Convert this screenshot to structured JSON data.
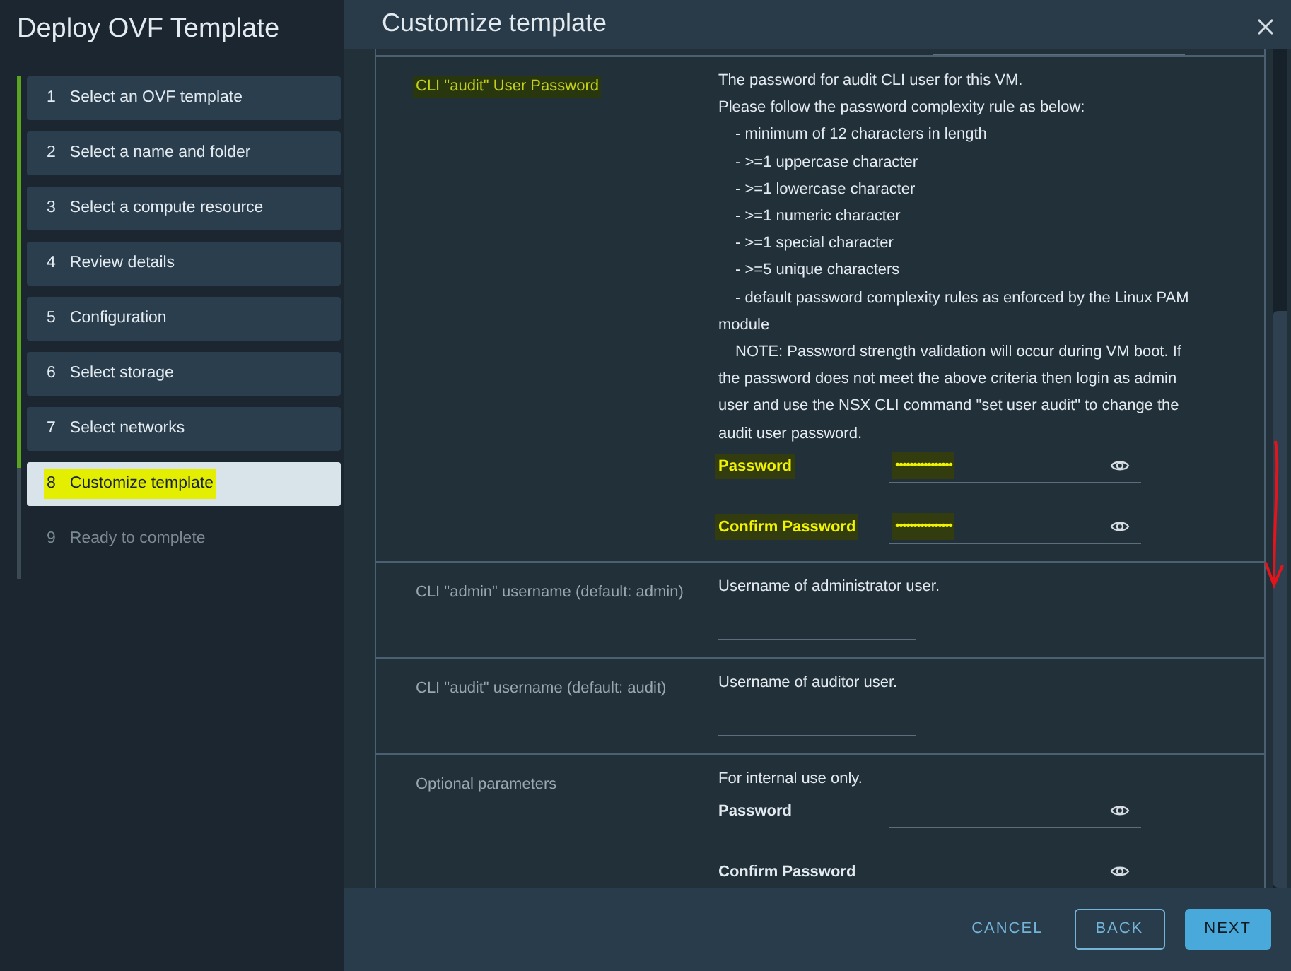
{
  "wizard": {
    "title": "Deploy OVF Template",
    "steps": [
      {
        "number": "1",
        "label": "Select an OVF template",
        "completed": true,
        "selected": false,
        "highlighted": false
      },
      {
        "number": "2",
        "label": "Select a name and folder",
        "completed": true,
        "selected": false,
        "highlighted": false
      },
      {
        "number": "3",
        "label": "Select a compute resource",
        "completed": true,
        "selected": false,
        "highlighted": false
      },
      {
        "number": "4",
        "label": "Review details",
        "completed": true,
        "selected": false,
        "highlighted": false
      },
      {
        "number": "5",
        "label": "Configuration",
        "completed": true,
        "selected": false,
        "highlighted": false
      },
      {
        "number": "6",
        "label": "Select storage",
        "completed": true,
        "selected": false,
        "highlighted": false
      },
      {
        "number": "7",
        "label": "Select networks",
        "completed": true,
        "selected": false,
        "highlighted": false
      },
      {
        "number": "8",
        "label": "Customize template",
        "completed": false,
        "selected": true,
        "highlighted": true
      },
      {
        "number": "9",
        "label": "Ready to complete",
        "completed": false,
        "selected": false,
        "highlighted": false
      }
    ]
  },
  "page": {
    "title": "Customize template"
  },
  "properties": [
    {
      "label": "CLI \"audit\" User Password",
      "highlighted": true,
      "description": [
        {
          "kind": "line",
          "text": "The password for audit CLI user for this VM."
        },
        {
          "kind": "line",
          "text": "Please follow the password complexity rule as below:"
        },
        {
          "kind": "rule",
          "text": "- minimum of 12 characters in length"
        },
        {
          "kind": "rule",
          "text": "- >=1 uppercase character"
        },
        {
          "kind": "rule",
          "text": "- >=1 lowercase character"
        },
        {
          "kind": "rule",
          "text": "- >=1 numeric character"
        },
        {
          "kind": "rule",
          "text": "- >=1 special character"
        },
        {
          "kind": "rule",
          "text": "- >=5 unique characters"
        },
        {
          "kind": "rule_wrap",
          "text": "- default password complexity rules as enforced by the Linux PAM module"
        },
        {
          "kind": "note",
          "text": "NOTE: Password strength validation will occur during VM boot.  If the password does not meet the above criteria then login as admin user and use the NSX CLI command \"set user audit\" to change the audit user password."
        }
      ],
      "fields": [
        {
          "kind": "password",
          "label": "Password",
          "value": "••••••••••••••••",
          "highlighted": true
        },
        {
          "kind": "password",
          "label": "Confirm Password",
          "value": "••••••••••••••••",
          "highlighted": true
        }
      ]
    },
    {
      "label": "CLI \"admin\" username (default: admin)",
      "highlighted": false,
      "description": [
        {
          "kind": "line",
          "text": "Username of administrator user."
        }
      ],
      "fields": [
        {
          "kind": "text"
        }
      ]
    },
    {
      "label": "CLI \"audit\" username (default: audit)",
      "highlighted": false,
      "description": [
        {
          "kind": "line",
          "text": "Username of auditor user."
        }
      ],
      "fields": [
        {
          "kind": "text"
        }
      ]
    },
    {
      "label": "Optional parameters",
      "highlighted": false,
      "description": [
        {
          "kind": "line",
          "text": "For internal use only."
        }
      ],
      "fields": [
        {
          "kind": "password",
          "label": "Password",
          "highlighted": false
        },
        {
          "kind": "password",
          "label": "Confirm Password",
          "highlighted": false
        }
      ]
    }
  ],
  "buttons": [
    {
      "label": "CANCEL",
      "kind": "link"
    },
    {
      "label": "BACK",
      "kind": "outline"
    },
    {
      "label": "NEXT",
      "kind": "primary"
    }
  ]
}
